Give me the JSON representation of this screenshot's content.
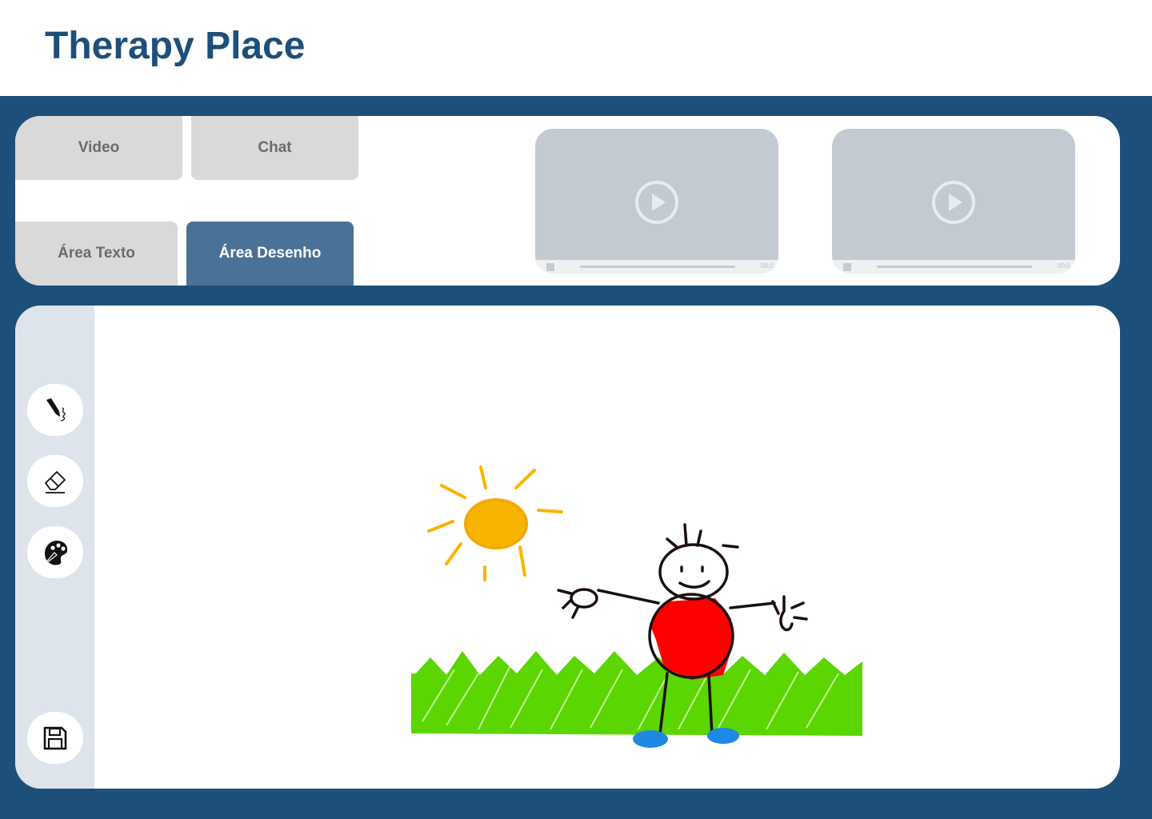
{
  "app": {
    "title": "Therapy Place"
  },
  "tabs": {
    "video": "Video",
    "chat": "Chat",
    "text_area": "Área Texto",
    "drawing_area": "Área Desenho"
  },
  "videos": [
    {
      "time": "00:0"
    },
    {
      "time": "00:0"
    }
  ],
  "toolbar": {
    "tools": [
      "pen-icon",
      "eraser-icon",
      "palette-icon"
    ],
    "save": "save-icon"
  },
  "colors": {
    "brand": "#1d4f79",
    "active_tab": "#4a7196",
    "inactive_tab": "#d9d9d9",
    "sun": "#f7b500",
    "shirt": "#ff0000",
    "grass": "#5bd600",
    "shoes": "#1e88e5"
  }
}
